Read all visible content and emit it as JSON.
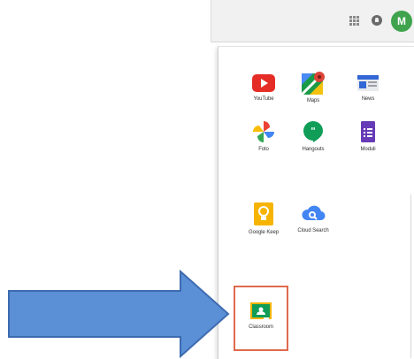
{
  "apps": [
    {
      "id": "youtube",
      "label": "YouTube"
    },
    {
      "id": "maps",
      "label": "Maps"
    },
    {
      "id": "news",
      "label": "News"
    },
    {
      "id": "photos",
      "label": "Foto"
    },
    {
      "id": "hangouts",
      "label": "Hangouts"
    },
    {
      "id": "forms",
      "label": "Moduli"
    },
    {
      "id": "keep",
      "label": "Google Keep"
    },
    {
      "id": "cloud-search",
      "label": "Cloud Search"
    },
    {
      "id": "classroom",
      "label": "Classroom"
    }
  ],
  "header": {
    "avatar_letter": "M"
  },
  "colors": {
    "arrow_fill": "#5b8fd6",
    "arrow_stroke": "#3d6bb0",
    "highlight": "#e06a4e",
    "avatar": "#3fa34d"
  }
}
